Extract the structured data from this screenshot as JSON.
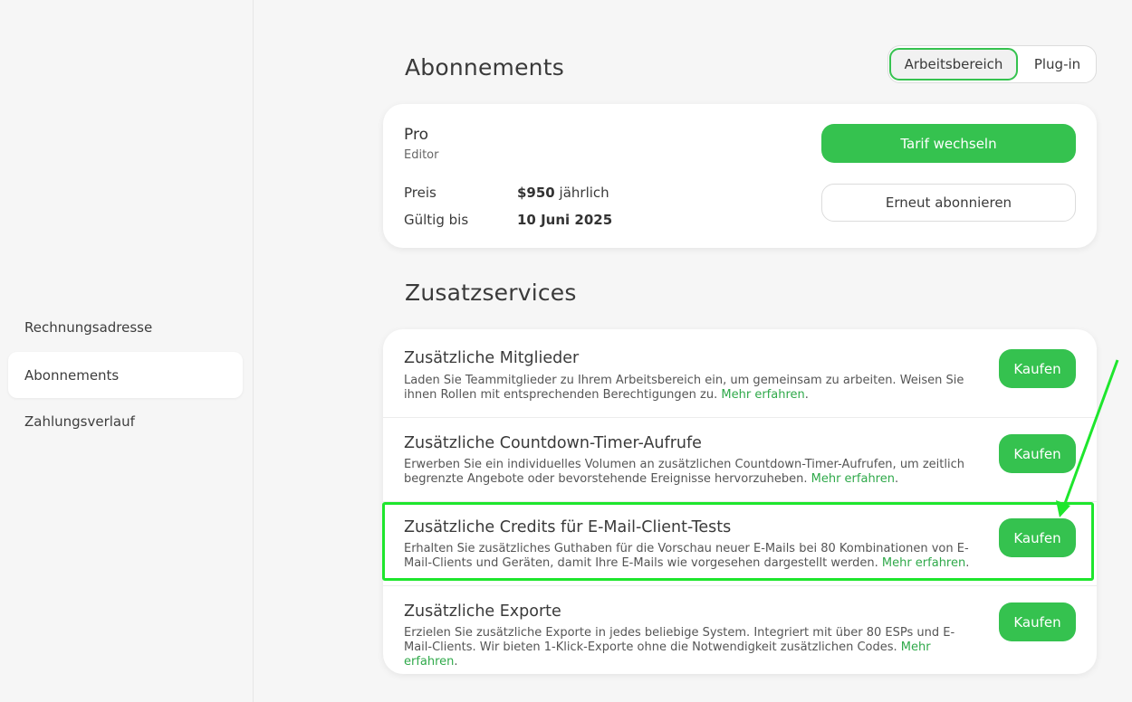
{
  "sidebar": {
    "items": [
      {
        "label": "Rechnungsadresse",
        "active": false
      },
      {
        "label": "Abonnements",
        "active": true
      },
      {
        "label": "Zahlungsverlauf",
        "active": false
      }
    ]
  },
  "header": {
    "title": "Abonnements",
    "toggle": {
      "options": [
        "Arbeitsbereich",
        "Plug-in"
      ],
      "selected": "Arbeitsbereich"
    }
  },
  "plan": {
    "name": "Pro",
    "role": "Editor",
    "price_label": "Preis",
    "price_value": "$950",
    "price_period": "jährlich",
    "valid_label": "Gültig bis",
    "valid_value": "10 Juni 2025",
    "change_button": "Tarif wechseln",
    "resubscribe_button": "Erneut abonnieren"
  },
  "addons": {
    "title": "Zusatzservices",
    "buy_label": "Kaufen",
    "link_label": "Mehr erfahren",
    "items": [
      {
        "title": "Zusätzliche Mitglieder",
        "desc": "Laden Sie Teammitglieder zu Ihrem Arbeitsbereich ein, um gemeinsam zu arbeiten. Weisen Sie ihnen Rollen mit entsprechenden Berechtigungen zu."
      },
      {
        "title": "Zusätzliche Countdown-Timer-Aufrufe",
        "desc": "Erwerben Sie ein individuelles Volumen an zusätzlichen Countdown-Timer-Aufrufen, um zeitlich begrenzte Angebote oder bevorstehende Ereignisse hervorzuheben."
      },
      {
        "title": "Zusätzliche Credits für E-Mail-Client-Tests",
        "desc": "Erhalten Sie zusätzliches Guthaben für die Vorschau neuer E-Mails bei 80 Kombinationen von E-Mail-Clients und Geräten, damit Ihre E-Mails wie vorgesehen dargestellt werden.",
        "highlighted": true
      },
      {
        "title": "Zusätzliche Exporte",
        "desc": "Erzielen Sie zusätzliche Exporte in jedes beliebige System. Integriert mit über 80 ESPs und E-Mail-Clients. Wir bieten 1-Klick-Exporte ohne die Notwendigkeit zusätzlichen Codes."
      }
    ]
  },
  "colors": {
    "accent": "#35c24f",
    "link": "#2fa94a",
    "highlight": "#1ee62d",
    "background": "#f6f6f6"
  }
}
